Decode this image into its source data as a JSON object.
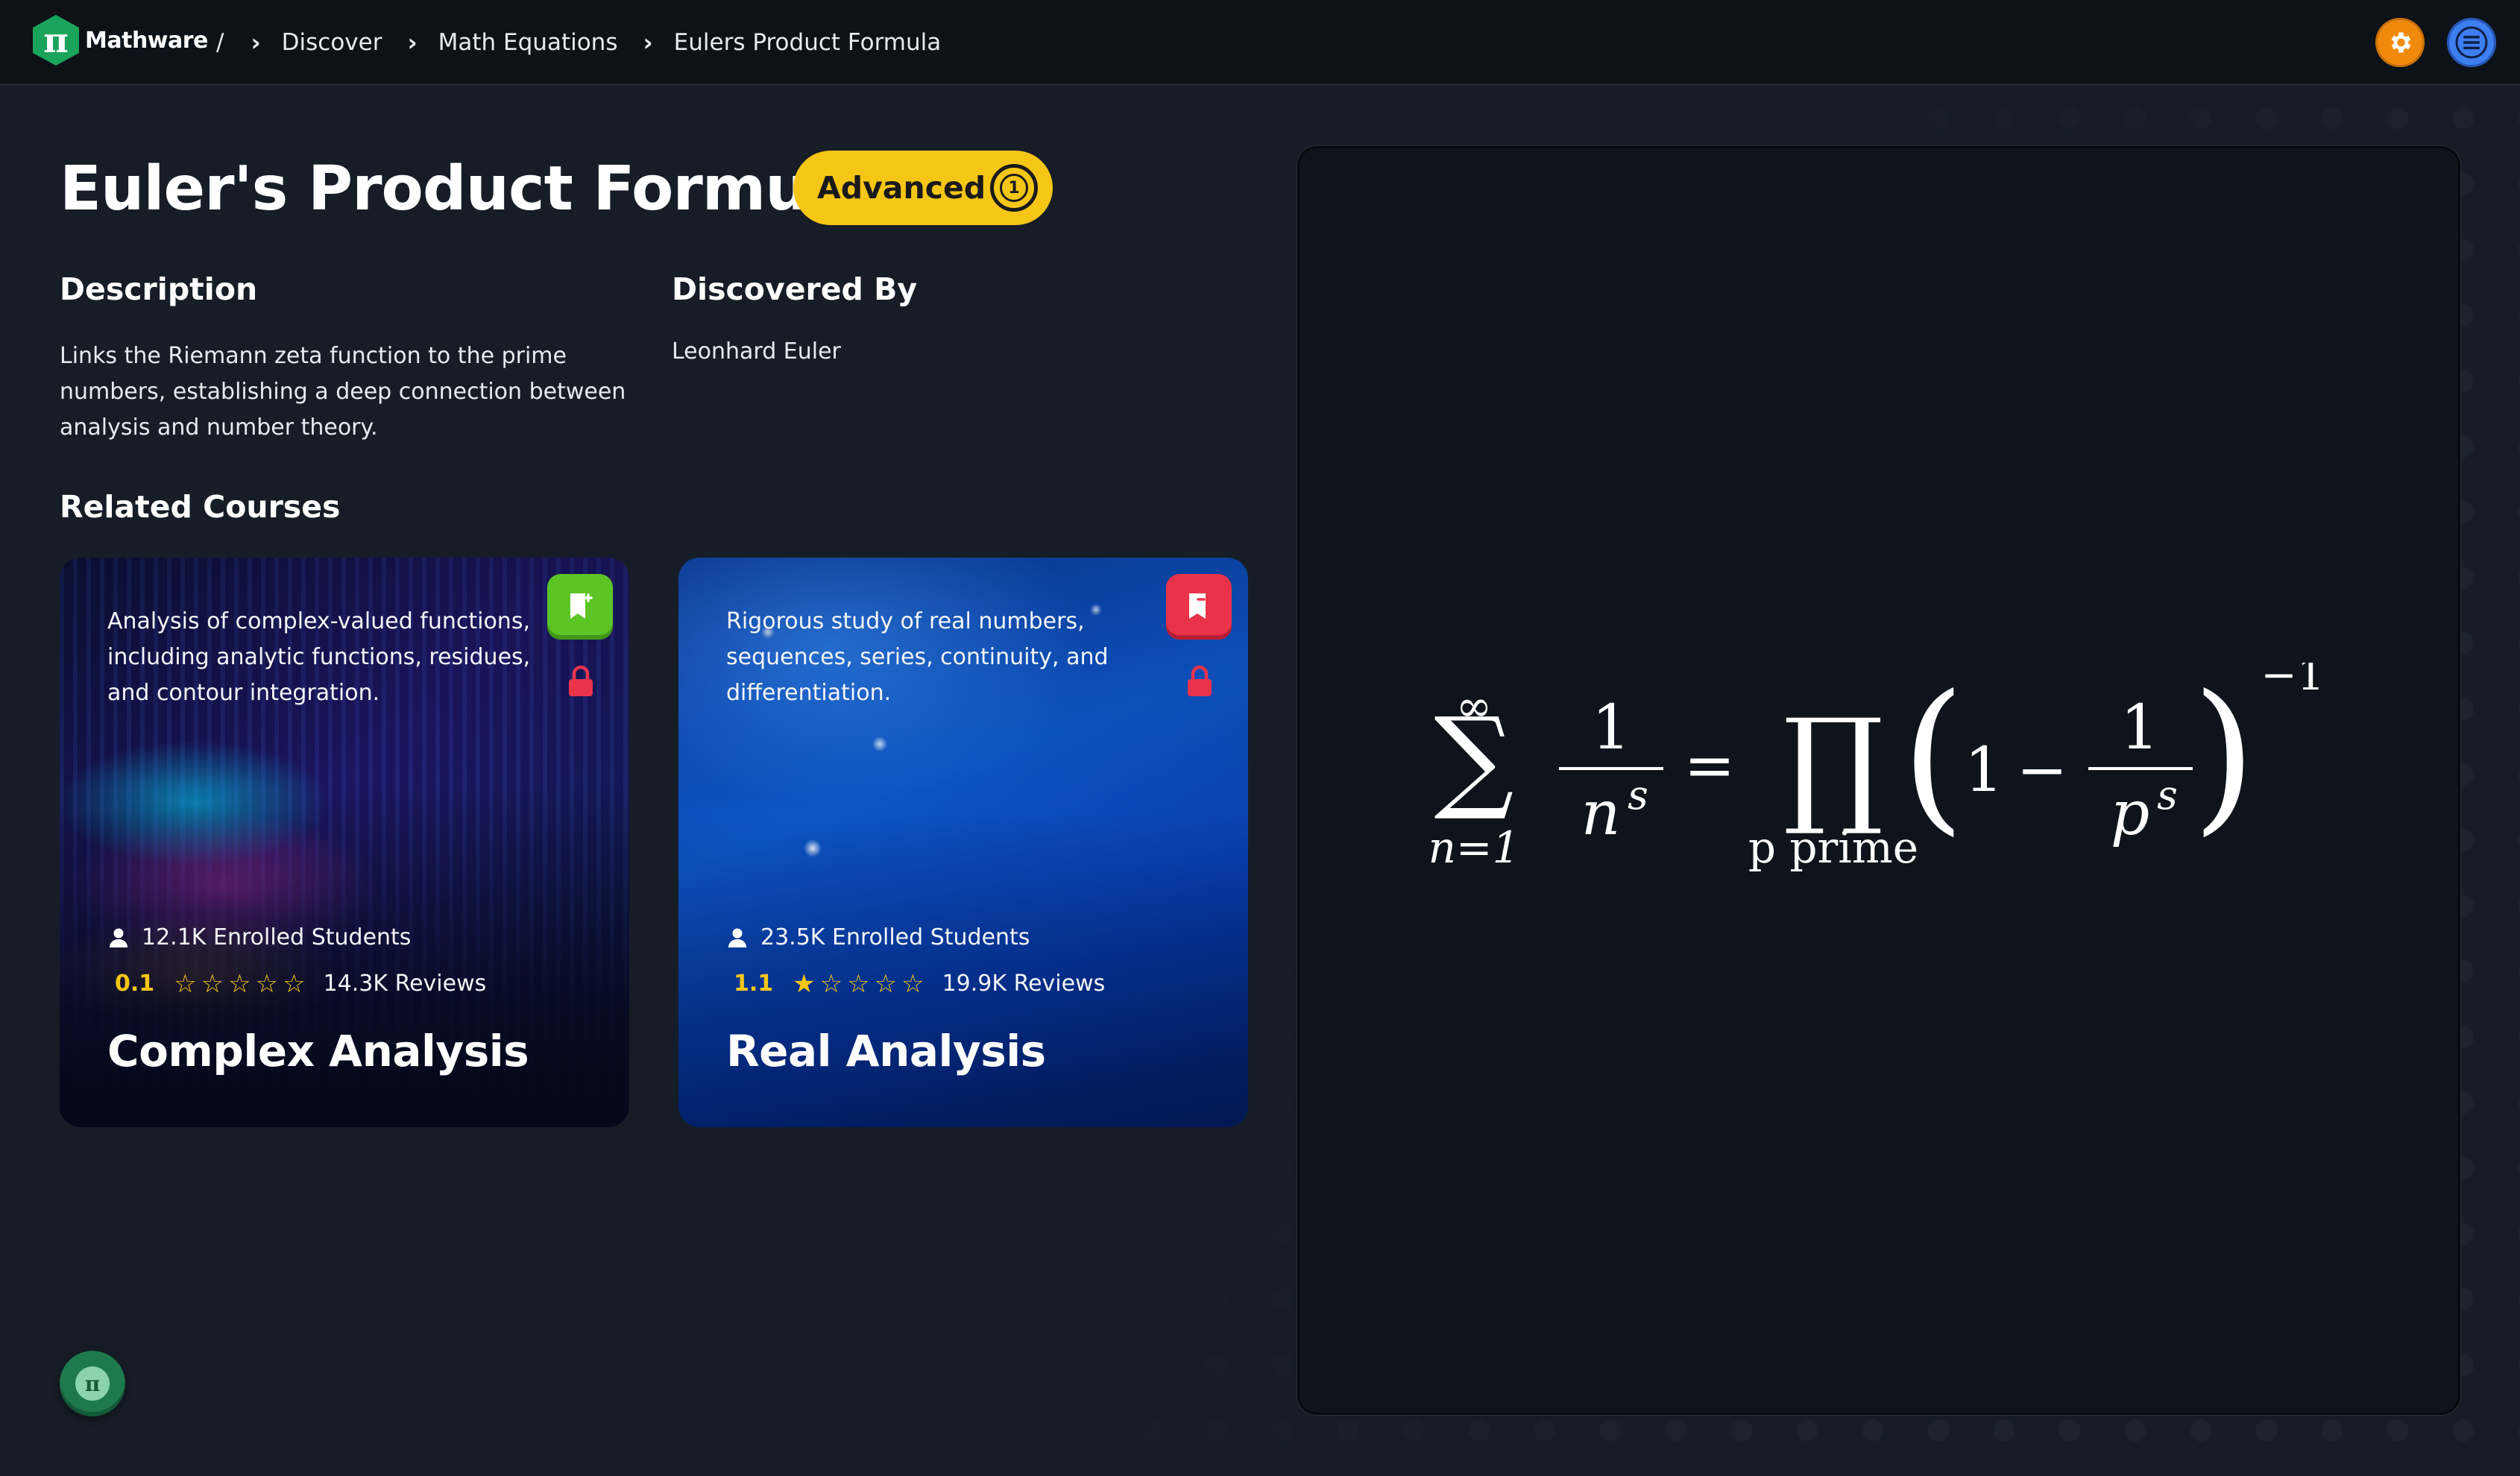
{
  "app": {
    "name": "Mathware",
    "logo_glyph": "π"
  },
  "breadcrumb": {
    "separator": "/",
    "items": [
      "Discover",
      "Math Equations",
      "Eulers Product Formula"
    ]
  },
  "header_actions": {
    "settings_icon": "gear-icon",
    "menu_icon": "hamburger-menu-icon"
  },
  "equation": {
    "title": "Euler's Product Formula",
    "level": "Advanced",
    "level_medal_number": "1",
    "description_heading": "Description",
    "description": "Links the Riemann zeta function to the prime numbers, establishing a deep connection between analysis and number theory.",
    "discovered_heading": "Discovered By",
    "discovered_by": "Leonhard Euler",
    "formula": {
      "sum_upper": "∞",
      "sum_lower": "n=1",
      "lhs_num": "1",
      "lhs_den_base": "n",
      "lhs_den_exp": "s",
      "product_lower": "p prime",
      "rhs_one": "1",
      "rhs_minus": "−",
      "rhs_num": "1",
      "rhs_den_base": "p",
      "rhs_den_exp": "s",
      "outer_exp": "−1"
    }
  },
  "related": {
    "heading": "Related Courses",
    "courses": [
      {
        "title": "Complex Analysis",
        "description": "Analysis of complex-valued functions, including analytic functions, residues, and contour integration.",
        "enrolled": "12.1K Enrolled Students",
        "rating": "0.1",
        "rating_stars": 0,
        "reviews": "14.3K Reviews",
        "bookmark_state": "add",
        "locked": true
      },
      {
        "title": "Real Analysis",
        "description": "Rigorous study of real numbers, sequences, series, continuity, and differentiation.",
        "enrolled": "23.5K Enrolled Students",
        "rating": "1.1",
        "rating_stars": 1,
        "reviews": "19.9K Reviews",
        "bookmark_state": "remove",
        "locked": true
      }
    ]
  },
  "fab": {
    "glyph": "π"
  },
  "colors": {
    "accent_yellow": "#f6c617",
    "brand_green": "#1aa35a",
    "settings_orange": "#f08a0c",
    "menu_blue": "#3d7ff0",
    "bookmark_add_green": "#5cc424",
    "bookmark_remove_red": "#e8334b"
  }
}
